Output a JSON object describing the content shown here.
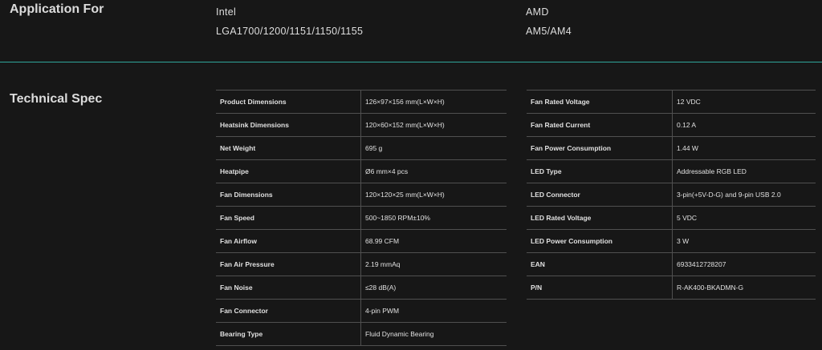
{
  "application": {
    "title": "Application For",
    "intel": {
      "brand": "Intel",
      "sockets": "LGA1700/1200/1151/1150/1155"
    },
    "amd": {
      "brand": "AMD",
      "sockets": "AM5/AM4"
    }
  },
  "technical_spec": {
    "title": "Technical Spec",
    "left": [
      {
        "key": "Product Dimensions",
        "value": "126×97×156 mm(L×W×H)"
      },
      {
        "key": "Heatsink Dimensions",
        "value": "120×60×152 mm(L×W×H)"
      },
      {
        "key": "Net Weight",
        "value": "695 g"
      },
      {
        "key": "Heatpipe",
        "value": "Ø6 mm×4 pcs"
      },
      {
        "key": "Fan Dimensions",
        "value": "120×120×25 mm(L×W×H)"
      },
      {
        "key": "Fan Speed",
        "value": "500~1850 RPM±10%"
      },
      {
        "key": "Fan Airflow",
        "value": "68.99 CFM"
      },
      {
        "key": "Fan Air Pressure",
        "value": "2.19 mmAq"
      },
      {
        "key": "Fan Noise",
        "value": "≤28 dB(A)"
      },
      {
        "key": "Fan Connector",
        "value": "4-pin PWM"
      },
      {
        "key": "Bearing Type",
        "value": "Fluid Dynamic Bearing"
      }
    ],
    "right": [
      {
        "key": "Fan Rated Voltage",
        "value": "12 VDC"
      },
      {
        "key": "Fan Rated Current",
        "value": "0.12 A"
      },
      {
        "key": "Fan Power Consumption",
        "value": "1.44 W"
      },
      {
        "key": "LED Type",
        "value": "Addressable RGB LED"
      },
      {
        "key": "LED Connector",
        "value": "3-pin(+5V-D-G) and 9-pin USB 2.0"
      },
      {
        "key": "LED Rated Voltage",
        "value": "5 VDC"
      },
      {
        "key": "LED Power Consumption",
        "value": "3 W"
      },
      {
        "key": "EAN",
        "value": "6933412728207"
      },
      {
        "key": "P/N",
        "value": "R-AK400-BKADMN-G"
      }
    ]
  },
  "colors": {
    "background": "#171717",
    "divider": "#2fa79b",
    "table_border": "#505050"
  }
}
